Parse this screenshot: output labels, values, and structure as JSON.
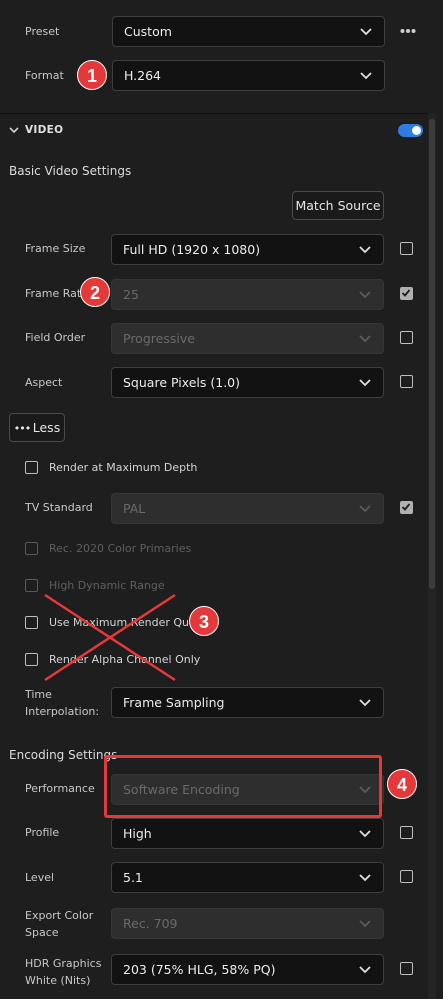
{
  "preset": {
    "label": "Preset",
    "value": "Custom"
  },
  "format": {
    "label": "Format",
    "value": "H.264"
  },
  "video_section": {
    "title": "VIDEO",
    "toggle_on": true
  },
  "basic": {
    "title": "Basic Video Settings",
    "match_source_label": "Match Source",
    "frame_size": {
      "label": "Frame Size",
      "value": "Full HD (1920 x 1080)",
      "checked": false
    },
    "frame_rate": {
      "label": "Frame Rate",
      "value": "25",
      "checked": true
    },
    "field_order": {
      "label": "Field Order",
      "value": "Progressive",
      "checked": false
    },
    "aspect": {
      "label": "Aspect",
      "value": "Square Pixels (1.0)",
      "checked": false
    },
    "less_label": "Less",
    "render_max_depth": "Render at Maximum Depth",
    "tv_standard": {
      "label": "TV Standard",
      "value": "PAL",
      "checked": true
    },
    "rec2020": "Rec. 2020 Color Primaries",
    "hdr": "High Dynamic Range",
    "max_render_quality": "Use Maximum Render Quality",
    "alpha_only": "Render Alpha Channel Only",
    "time_interp": {
      "label_line1": "Time",
      "label_line2": "Interpolation:",
      "value": "Frame Sampling"
    }
  },
  "encoding": {
    "title": "Encoding Settings",
    "performance": {
      "label": "Performance",
      "value": "Software Encoding"
    },
    "profile": {
      "label": "Profile",
      "value": "High",
      "checked": false
    },
    "level": {
      "label": "Level",
      "value": "5.1",
      "checked": false
    },
    "export_color_space": {
      "label_line1": "Export Color",
      "label_line2": "Space",
      "value": "Rec. 709"
    },
    "hdr_white": {
      "label_line1": "HDR Graphics",
      "label_line2": "White (Nits)",
      "value": "203 (75% HLG, 58% PQ)",
      "checked": false
    }
  },
  "annotations": {
    "badge1": "1",
    "badge2": "2",
    "badge3": "3",
    "badge4": "4"
  },
  "colors": {
    "accent": "#2f7de1",
    "annotation_red": "#e5383b",
    "background": "#1e1e1e"
  }
}
